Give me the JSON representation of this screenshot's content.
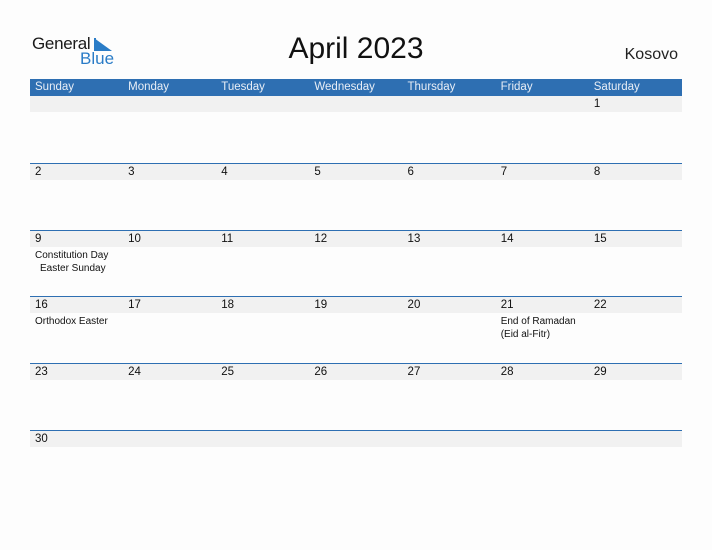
{
  "logo": {
    "general": "General",
    "blue": "Blue"
  },
  "title": "April 2023",
  "country": "Kosovo",
  "weekdays": [
    "Sunday",
    "Monday",
    "Tuesday",
    "Wednesday",
    "Thursday",
    "Friday",
    "Saturday"
  ],
  "weeks": [
    {
      "days": [
        "",
        "",
        "",
        "",
        "",
        "",
        "1"
      ]
    },
    {
      "days": [
        "2",
        "3",
        "4",
        "5",
        "6",
        "7",
        "8"
      ]
    },
    {
      "days": [
        "9",
        "10",
        "11",
        "12",
        "13",
        "14",
        "15"
      ]
    },
    {
      "days": [
        "16",
        "17",
        "18",
        "19",
        "20",
        "21",
        "22"
      ]
    },
    {
      "days": [
        "23",
        "24",
        "25",
        "26",
        "27",
        "28",
        "29"
      ]
    },
    {
      "days": [
        "30",
        "",
        "",
        "",
        "",
        "",
        ""
      ]
    }
  ],
  "holidays": {
    "d9": [
      "Constitution Day",
      "Easter Sunday"
    ],
    "d16": [
      "Orthodox Easter"
    ],
    "d21": [
      "End of Ramadan",
      "(Eid al-Fitr)"
    ]
  }
}
